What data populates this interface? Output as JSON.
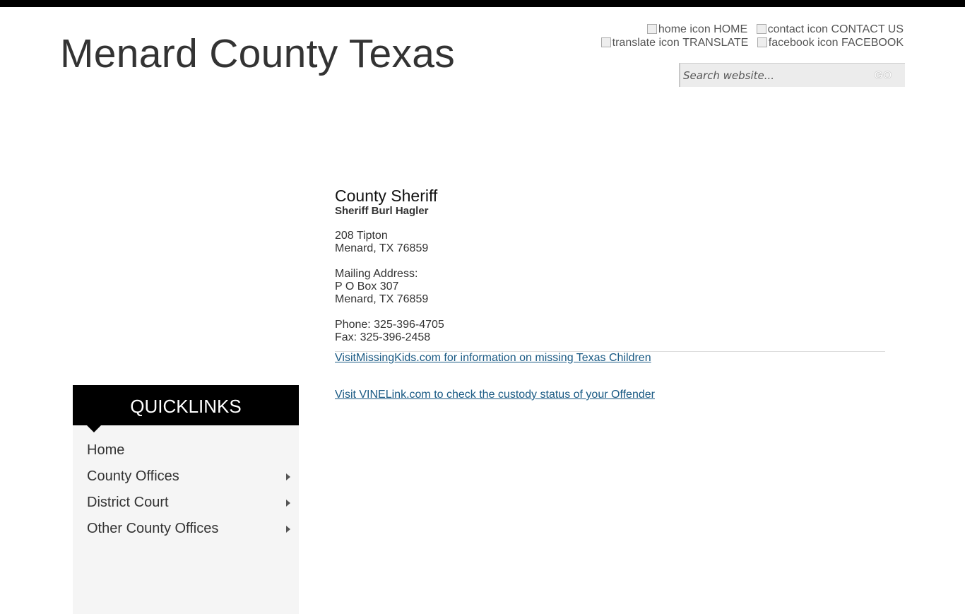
{
  "site": {
    "title": "Menard County Texas"
  },
  "utility_links": [
    {
      "icon_alt": "home icon",
      "label": "HOME",
      "icon": "home-icon"
    },
    {
      "icon_alt": "contact icon",
      "label": "CONTACT US",
      "icon": "contact-icon"
    },
    {
      "icon_alt": "translate icon",
      "label": "TRANSLATE",
      "icon": "translate-icon"
    },
    {
      "icon_alt": "facebook icon",
      "label": "FACEBOOK",
      "icon": "facebook-icon"
    }
  ],
  "search": {
    "placeholder": "Search website...",
    "value": "",
    "button_label": "GO"
  },
  "main": {
    "heading": "County Sheriff",
    "sheriff_name": "Sheriff Burl Hagler",
    "street_address": [
      "208 Tipton",
      "Menard, TX 76859"
    ],
    "mailing_label": "Mailing Address:",
    "mailing_address": [
      "P O Box 307",
      "Menard, TX 76859"
    ],
    "phone": "Phone: 325-396-4705",
    "fax": "Fax: 325-396-2458",
    "links": [
      "VisitMissingKids.com for information on missing Texas Children",
      "Visit VINELink.com to check the custody status of your Offender"
    ]
  },
  "quicklinks": {
    "header": "QUICKLINKS",
    "items": [
      {
        "label": "Home",
        "has_submenu": false
      },
      {
        "label": "County Offices",
        "has_submenu": true
      },
      {
        "label": "District Court",
        "has_submenu": true
      },
      {
        "label": "Other County Offices",
        "has_submenu": true
      }
    ]
  },
  "colors": {
    "top_bar": "#000000",
    "link": "#1a5a84",
    "quicklinks_header": "#000000",
    "quicklinks_bg": "#f5f5f5"
  }
}
